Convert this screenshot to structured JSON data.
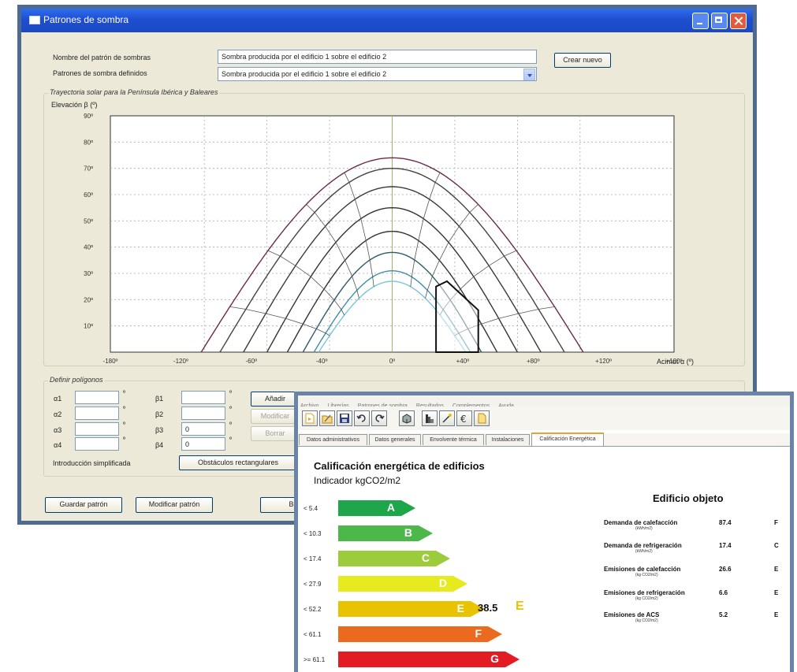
{
  "window1": {
    "title": "Patrones de sombra",
    "name_label": "Nombre del patrón de sombras",
    "name_value": "Sombra producida por el edificio 1 sobre el edificio 2",
    "create_button": "Crear nuevo",
    "patterns_label": "Patrones de sombra definidos",
    "patterns_selected": "Sombra producida por el edificio 1 sobre el edificio 2",
    "chart_group_title": "Trayectoria solar para la Península Ibérica y Baleares",
    "poly_group_title": "Definir polígonos",
    "alpha_labels": [
      "α1",
      "α2",
      "α3",
      "α4"
    ],
    "beta_labels": [
      "β1",
      "β2",
      "β3",
      "β4"
    ],
    "beta_values": [
      "",
      "",
      "0",
      "0"
    ],
    "add_button": "Añadir",
    "modify_button": "Modificar",
    "delete_button": "Borrar",
    "simplified_label": "Introducción simplificada",
    "rect_obstacles_button": "Obstáculos rectangulares",
    "save_button": "Guardar patrón",
    "modify_pattern_button": "Modificar patrón",
    "delete_pattern_button": "Borrar"
  },
  "chart_data": {
    "type": "line",
    "ylabel": "Elevación β (º)",
    "xlabel": "Acimut α (º)",
    "xlim": [
      -180,
      180
    ],
    "ylim": [
      0,
      90
    ],
    "x_ticks": [
      "-180º",
      "-120º",
      "-60º",
      "-40º",
      "0º",
      "+40º",
      "+80º",
      "+120º",
      "+180º"
    ],
    "y_ticks": [
      "10º",
      "20º",
      "30º",
      "40º",
      "50º",
      "60º",
      "70º",
      "80º",
      "90º"
    ],
    "grid": true,
    "series": [
      {
        "peak": 74,
        "half_width": 122
      },
      {
        "peak": 70,
        "half_width": 110
      },
      {
        "peak": 63,
        "half_width": 95
      },
      {
        "peak": 55,
        "half_width": 80
      },
      {
        "peak": 46,
        "half_width": 67
      },
      {
        "peak": 38,
        "half_width": 57
      },
      {
        "peak": 31,
        "half_width": 50
      },
      {
        "peak": 27,
        "half_width": 47
      }
    ],
    "shadow_polygon": [
      [
        28,
        0
      ],
      [
        28,
        25
      ],
      [
        35,
        27
      ],
      [
        55,
        16
      ],
      [
        55,
        0
      ]
    ]
  },
  "window2": {
    "menu": [
      "Archivo",
      "Librerías",
      "Patrones de sombra",
      "Resultados",
      "Complementos",
      "Ayuda"
    ],
    "tabs": [
      "Datos administrativos",
      "Datos generales",
      "Envolvente térmica",
      "Instalaciones",
      "Calificación Energética"
    ],
    "active_tab": "Calificación Energética",
    "title": "Calificación energética de edificios",
    "indicator": "Indicador kgCO2/m2",
    "ratings": [
      {
        "label": "< 5.4",
        "letter": "A",
        "color": "#1ea64a"
      },
      {
        "label": "< 10.3",
        "letter": "B",
        "color": "#4cb849"
      },
      {
        "label": "< 17.4",
        "letter": "C",
        "color": "#9ccb3b"
      },
      {
        "label": "< 27.9",
        "letter": "D",
        "color": "#e7ea1f"
      },
      {
        "label": "< 52.2",
        "letter": "E",
        "color": "#e9c300"
      },
      {
        "label": "< 61.1",
        "letter": "F",
        "color": "#ec6a1f"
      },
      {
        "label": ">= 61.1",
        "letter": "G",
        "color": "#e31b23"
      }
    ],
    "result_value": "38.5",
    "result_letter": "E",
    "object_title": "Edificio objeto",
    "indicators": [
      {
        "name": "Demanda de calefacción",
        "unit": "(kWh/m2)",
        "value": "87.4",
        "letter": "F"
      },
      {
        "name": "Demanda de refrigeración",
        "unit": "(kWh/m2)",
        "value": "17.4",
        "letter": "C"
      },
      {
        "name": "Emisiones de calefacción",
        "unit": "(kg CO2/m2)",
        "value": "26.6",
        "letter": "E"
      },
      {
        "name": "Emisiones de refrigeración",
        "unit": "(kg CO2/m2)",
        "value": "6.6",
        "letter": "E"
      },
      {
        "name": "Emisiones de ACS",
        "unit": "(kg CO2/m2)",
        "value": "5.2",
        "letter": "E"
      }
    ]
  }
}
